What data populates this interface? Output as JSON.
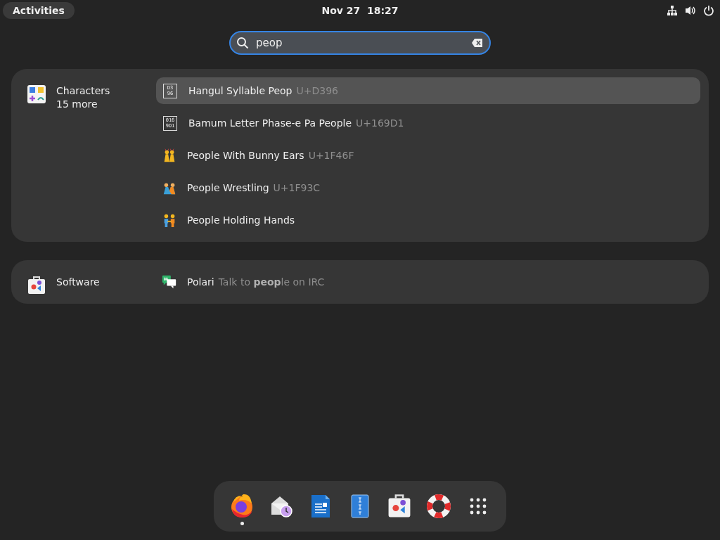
{
  "top_bar": {
    "activities": "Activities",
    "clock": "Nov 27  18:27"
  },
  "search": {
    "value": "peop"
  },
  "providers": [
    {
      "name": "Characters",
      "more": "15 more",
      "kind": "characters",
      "results": [
        {
          "kind": "hexbox",
          "box_digits": [
            "D3",
            "96"
          ],
          "title": "Hangul Syllable Peop",
          "code": "U+D396",
          "selected": true
        },
        {
          "kind": "hexbox",
          "box_digits": [
            "016",
            "9D1"
          ],
          "title": "Bamum Letter Phase-e Pa People",
          "code": "U+169D1",
          "selected": false
        },
        {
          "kind": "bunny",
          "title": "People With Bunny Ears",
          "code": "U+1F46F",
          "selected": false
        },
        {
          "kind": "wrestling",
          "title": "People Wrestling",
          "code": "U+1F93C",
          "selected": false
        },
        {
          "kind": "hands",
          "title": "People Holding Hands",
          "selected": false
        }
      ]
    },
    {
      "name": "Software",
      "kind": "software",
      "results": [
        {
          "kind": "polari",
          "title": "Polari",
          "description": "Talk to **peop**le on IRC",
          "selected": false
        }
      ]
    }
  ],
  "dock": [
    {
      "kind": "firefox",
      "running": true
    },
    {
      "kind": "mail",
      "running": false
    },
    {
      "kind": "writer",
      "running": false
    },
    {
      "kind": "archive",
      "running": false
    },
    {
      "kind": "software",
      "running": false
    },
    {
      "kind": "help",
      "running": false
    },
    {
      "kind": "grid",
      "running": false
    }
  ]
}
